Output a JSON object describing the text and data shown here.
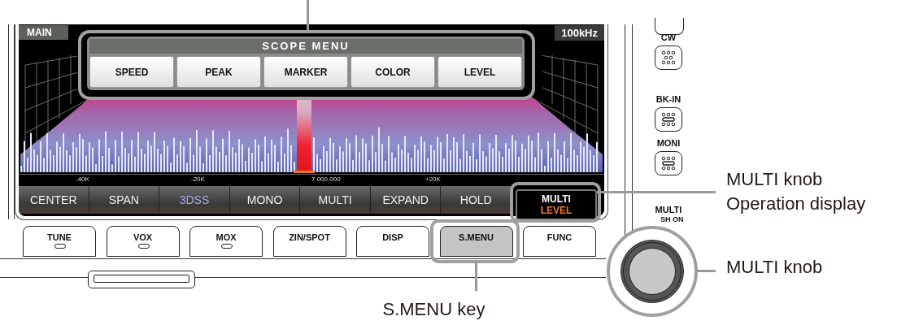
{
  "screen": {
    "header_left": "MAIN",
    "header_right": "100kHz",
    "scope_menu": {
      "title": "SCOPE MENU",
      "items": [
        "SPEED",
        "PEAK",
        "MARKER",
        "COLOR",
        "LEVEL"
      ]
    },
    "axis_labels": [
      "-40K",
      "-20K",
      "7.000.000",
      "+20K"
    ],
    "softkeys": [
      {
        "label": "CENTER",
        "selected": false
      },
      {
        "label": "SPAN",
        "selected": false
      },
      {
        "label": "3DSS",
        "selected": true
      },
      {
        "label": "MONO",
        "selected": false
      },
      {
        "label": "MULTI",
        "selected": false
      },
      {
        "label": "EXPAND",
        "selected": false
      },
      {
        "label": "HOLD",
        "selected": false
      }
    ],
    "multi_display": {
      "function": "MULTI",
      "value": "LEVEL"
    }
  },
  "front_keys": [
    {
      "label": "TUNE",
      "indicator": true,
      "highlighted": false
    },
    {
      "label": "VOX",
      "indicator": true,
      "highlighted": false
    },
    {
      "label": "MOX",
      "indicator": true,
      "highlighted": false
    },
    {
      "label": "ZIN/SPOT",
      "indicator": false,
      "highlighted": false
    },
    {
      "label": "DISP",
      "indicator": false,
      "highlighted": false
    },
    {
      "label": "S.MENU",
      "indicator": false,
      "highlighted": true
    },
    {
      "label": "FUNC",
      "indicator": false,
      "highlighted": false
    }
  ],
  "side_keys": [
    {
      "label": "CW",
      "kind": "dots"
    },
    {
      "label": "BK-IN",
      "kind": "bar"
    },
    {
      "label": "MONI",
      "kind": "bar"
    }
  ],
  "knob": {
    "label": "MULTI",
    "sublabel": "SH ON"
  },
  "callouts": {
    "multi_display": [
      "MULTI knob",
      "Operation display"
    ],
    "knob": "MULTI knob",
    "s_menu": "S.MENU key"
  }
}
